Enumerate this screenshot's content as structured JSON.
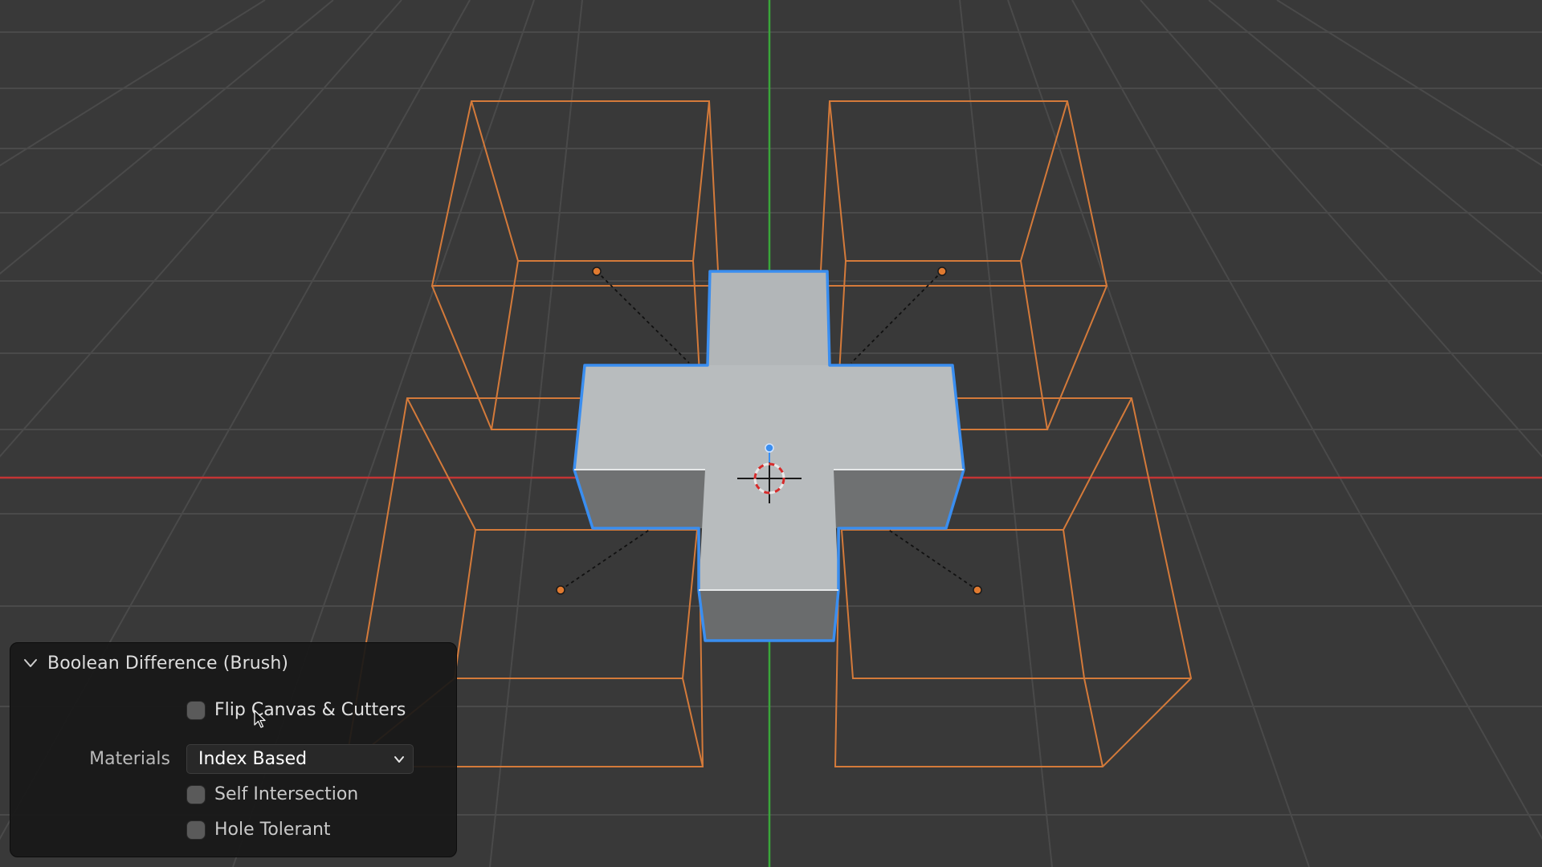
{
  "viewport": {
    "background": "#393939",
    "grid_color": "#4a4a4a",
    "x_axis_color": "#c43434",
    "y_axis_color": "#3aa63a",
    "cutter_wire_color": "#d47a3a",
    "mesh_outline_color": "#3a8ef0",
    "mesh_top_color": "#b9bdbf",
    "mesh_side_color": "#707273",
    "objects": {
      "canvas_mesh": "cross-shaped-mesh",
      "cutters": [
        "cutter-box-back-left",
        "cutter-box-back-right",
        "cutter-box-front-left",
        "cutter-box-front-right"
      ],
      "cursor_3d": "3d-cursor-icon"
    }
  },
  "operator_panel": {
    "title": "Boolean Difference (Brush)",
    "flip_canvas_cutters": {
      "label": "Flip Canvas & Cutters",
      "checked": false
    },
    "materials": {
      "label": "Materials",
      "value": "Index Based"
    },
    "self_intersection": {
      "label": "Self Intersection",
      "checked": false
    },
    "hole_tolerant": {
      "label": "Hole Tolerant",
      "checked": false
    }
  }
}
